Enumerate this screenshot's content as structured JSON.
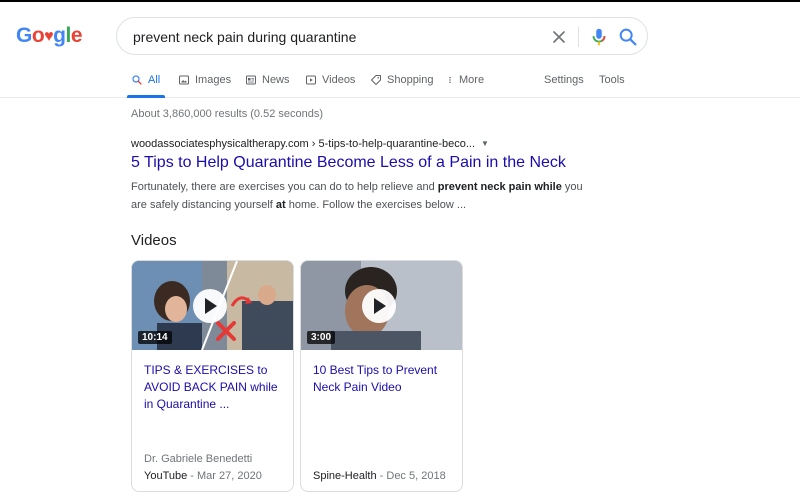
{
  "logo": {
    "g1": "G",
    "o1": "o",
    "heart": "♥",
    "g2": "g",
    "l": "l",
    "e": "e"
  },
  "search": {
    "query": "prevent neck pain during quarantine"
  },
  "tabs": [
    {
      "label": "All",
      "icon": "search-icon"
    },
    {
      "label": "Images",
      "icon": "image-icon"
    },
    {
      "label": "News",
      "icon": "news-icon"
    },
    {
      "label": "Videos",
      "icon": "video-icon"
    },
    {
      "label": "Shopping",
      "icon": "tag-icon"
    },
    {
      "label": "More",
      "icon": "more-vert-icon"
    },
    {
      "label": "Settings"
    },
    {
      "label": "Tools"
    }
  ],
  "result_stats": "About 3,860,000 results (0.52 seconds)",
  "result": {
    "url": "woodassociatesphysicaltherapy.com › 5-tips-to-help-quarantine-beco...",
    "title": "5 Tips to Help Quarantine Become Less of a Pain in the Neck",
    "snippet": {
      "p1": "Fortunately, there are exercises you can do to help relieve and ",
      "b1": "prevent neck pain while",
      "p2": " you are safely distancing yourself ",
      "b2": "at",
      "p3": " home. Follow the exercises below ..."
    }
  },
  "videos": {
    "heading": "Videos",
    "items": [
      {
        "duration": "10:14",
        "title": "TIPS & EXERCISES to AVOID BACK PAIN while in Quarantine ...",
        "author": "Dr. Gabriele Benedetti",
        "source": "YouTube",
        "date": " - Mar 27, 2020"
      },
      {
        "duration": "3:00",
        "title": "10 Best Tips to Prevent Neck Pain Video",
        "author": "",
        "source": "Spine-Health",
        "date": " - Dec 5, 2018"
      }
    ]
  },
  "colors": {
    "link": "#1a0dab",
    "accent": "#1a73e8",
    "muted": "#70757a"
  }
}
